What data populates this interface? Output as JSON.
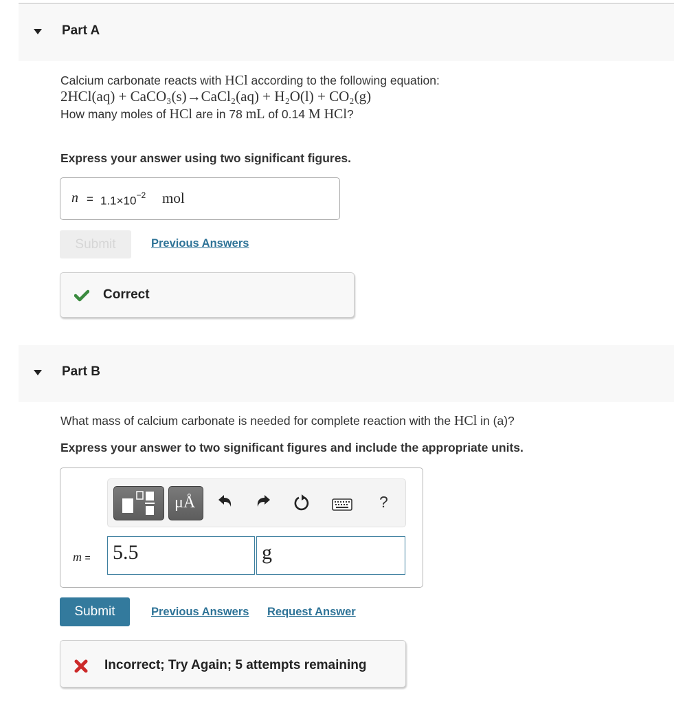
{
  "partA": {
    "title": "Part A",
    "intro": "Calcium carbonate reacts with",
    "intro_hcl": "HCl",
    "intro_end": "according to the following equation:",
    "equation": "2HCl(aq) + CaCO₃(s)→CaCl₂(aq) + H₂O(l) + CO₂(g)",
    "question_pre": "How many moles of",
    "question_hcl": "HCl",
    "question_mid": "are in 78",
    "question_ml": "mL",
    "question_of": "of 0.14",
    "question_m": "M HCl",
    "question_end": "?",
    "instruction": "Express your answer using two significant figures.",
    "answer": {
      "variable": "n",
      "equals": "=",
      "mantissa": "1.1×10",
      "exponent": "−2",
      "unit": "mol"
    },
    "submit_label": "Submit",
    "previous_answers_label": "Previous Answers",
    "feedback": {
      "status": "correct",
      "icon": "check-icon",
      "message": "Correct",
      "color": "#3a8a3e"
    }
  },
  "partB": {
    "title": "Part B",
    "question_pre": "What mass of calcium carbonate is needed for complete reaction with the",
    "question_hcl": "HCl",
    "question_end": "in (a)?",
    "instruction": "Express your answer to two significant figures and include the appropriate units.",
    "toolbar": {
      "templates_icon": "templates-icon",
      "units_label": "μÅ",
      "undo_icon": "undo-icon",
      "redo_icon": "redo-icon",
      "reset_icon": "reset-icon",
      "keyboard_icon": "keyboard-icon",
      "help_label": "?"
    },
    "answer": {
      "variable": "m",
      "equals": "=",
      "value": "5.5",
      "unit": "g"
    },
    "submit_label": "Submit",
    "previous_answers_label": "Previous Answers",
    "request_answer_label": "Request Answer",
    "feedback": {
      "status": "incorrect",
      "icon": "x-icon",
      "message": "Incorrect; Try Again; 5 attempts remaining",
      "color": "#cc2a2a"
    }
  },
  "colors": {
    "accent": "#337a9d",
    "link": "#2e7397",
    "header_bg": "#f8f8f8"
  }
}
